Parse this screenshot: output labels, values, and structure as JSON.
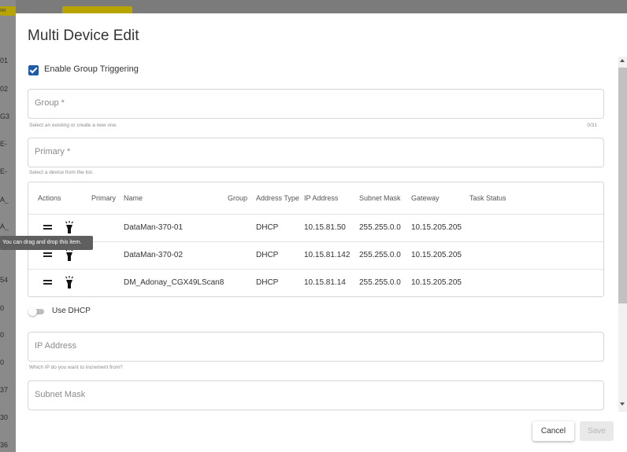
{
  "dialog": {
    "title": "Multi Device Edit",
    "enable_group_triggering": {
      "label": "Enable Group Triggering",
      "checked": true
    },
    "group_field": {
      "label": "Group *",
      "hint": "Select an existing or create a new one.",
      "counter": "0/31"
    },
    "primary_field": {
      "label": "Primary *",
      "hint": "Select a device from the list."
    },
    "table": {
      "columns": [
        "Actions",
        "Primary",
        "Name",
        "Group",
        "Address Type",
        "IP Address",
        "Subnet Mask",
        "Gateway",
        "Task Status"
      ],
      "rows": [
        {
          "name": "DataMan-370-01",
          "group": "",
          "address_type": "DHCP",
          "ip": "10.15.81.50",
          "subnet": "255.255.0.0",
          "gateway": "10.15.205.205",
          "status": ""
        },
        {
          "name": "DataMan-370-02",
          "group": "",
          "address_type": "DHCP",
          "ip": "10.15.81.142",
          "subnet": "255.255.0.0",
          "gateway": "10.15.205.205",
          "status": ""
        },
        {
          "name": "DM_Adonay_CGX49LScan8",
          "group": "",
          "address_type": "DHCP",
          "ip": "10.15.81.14",
          "subnet": "255.255.0.0",
          "gateway": "10.15.205.205",
          "status": ""
        }
      ]
    },
    "tooltip": "You can drag and drop this item.",
    "use_dhcp": {
      "label": "Use DHCP",
      "on": false
    },
    "ip_field": {
      "label": "IP Address",
      "hint": "Which IP do you want to increment from?"
    },
    "subnet_field": {
      "label": "Subnet Mask"
    },
    "buttons": {
      "cancel": "Cancel",
      "save": "Save"
    }
  },
  "background": {
    "side_labels": [
      "01",
      "02",
      "G3",
      "E-",
      "E-",
      "A_",
      "A_",
      "54",
      "0",
      "0",
      "0",
      "37",
      "30",
      "36"
    ],
    "button_text": "ıvı"
  },
  "colors": {
    "accent": "#1e5aa8",
    "overlay": "#7b7b7b",
    "background_button": "#b8a400"
  }
}
